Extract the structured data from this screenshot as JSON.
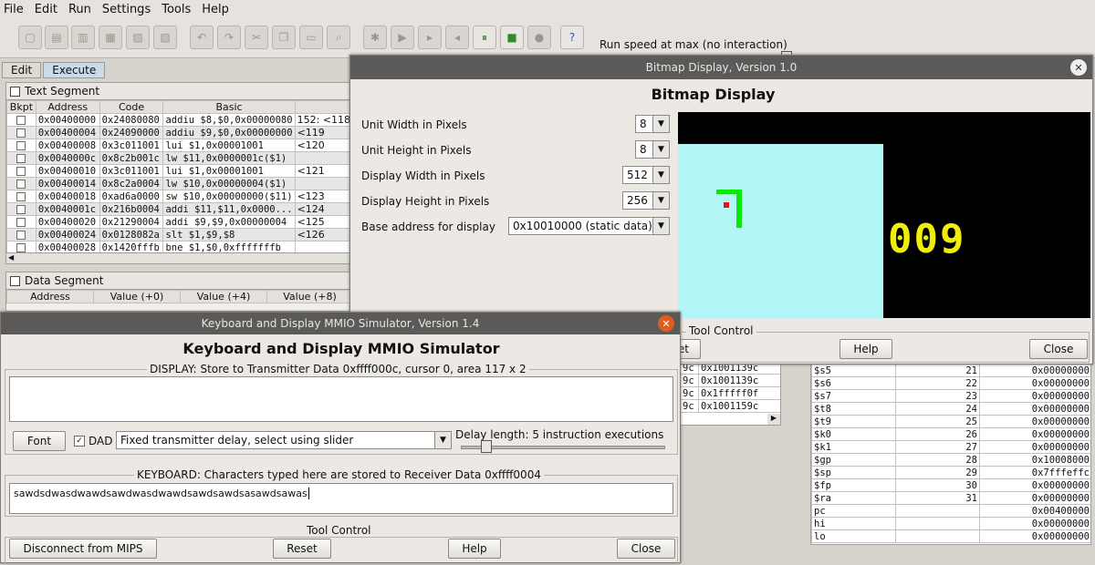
{
  "menu": [
    "File",
    "Edit",
    "Run",
    "Settings",
    "Tools",
    "Help"
  ],
  "toolbar": {
    "icons": [
      "new-icon",
      "open-icon",
      "close-file-icon",
      "save-icon",
      "dump-icon",
      "print-icon",
      "undo-icon",
      "redo-icon",
      "cut-icon",
      "copy-icon",
      "paste-icon",
      "find-icon",
      "assemble-icon",
      "run-icon",
      "step-icon",
      "backstep-icon",
      "pause-icon",
      "stop-icon",
      "reset-icon",
      "help-icon"
    ],
    "run_speed_label": "Run speed at max (no interaction)",
    "run_speed_fraction": 1.0
  },
  "tabs": {
    "edit": "Edit",
    "execute": "Execute"
  },
  "text_segment": {
    "title": "Text Segment",
    "headers": [
      "Bkpt",
      "Address",
      "Code",
      "Basic",
      ""
    ],
    "rows": [
      [
        "0x00400000",
        "0x24080080",
        "addiu $8,$0,0x00000080",
        "152:  <118"
      ],
      [
        "0x00400004",
        "0x24090000",
        "addiu $9,$0,0x00000000",
        "<119"
      ],
      [
        "0x00400008",
        "0x3c011001",
        "lui $1,0x00001001",
        "<120"
      ],
      [
        "0x0040000c",
        "0x8c2b001c",
        "lw $11,0x0000001c($1)",
        ""
      ],
      [
        "0x00400010",
        "0x3c011001",
        "lui $1,0x00001001",
        "<121"
      ],
      [
        "0x00400014",
        "0x8c2a0004",
        "lw $10,0x00000004($1)",
        ""
      ],
      [
        "0x00400018",
        "0xad6a0000",
        "sw $10,0x00000000($11)",
        "<123"
      ],
      [
        "0x0040001c",
        "0x216b0004",
        "addi $11,$11,0x0000...",
        "<124"
      ],
      [
        "0x00400020",
        "0x21290004",
        "addi $9,$9,0x00000004",
        "<125"
      ],
      [
        "0x00400024",
        "0x0128082a",
        "slt $1,$9,$8",
        "<126"
      ],
      [
        "0x00400028",
        "0x1420fffb",
        "bne $1,$0,0xfffffffb",
        ""
      ]
    ]
  },
  "data_segment": {
    "title": "Data Segment",
    "headers": [
      "Address",
      "Value (+0)",
      "Value (+4)",
      "Value (+8)"
    ],
    "partial_rows": [
      [
        "9c",
        "0x1001139c"
      ],
      [
        "9c",
        "0x1001139c"
      ],
      [
        "9c",
        "0x1fffff0f"
      ],
      [
        "9c",
        "0x1001159c"
      ]
    ],
    "partial_top": "0x100113..."
  },
  "bitmap": {
    "window_title": "Bitmap Display, Version 1.0",
    "heading": "Bitmap Display",
    "unit_width_label": "Unit Width in Pixels",
    "unit_width_value": "8",
    "unit_height_label": "Unit Height in Pixels",
    "unit_height_value": "8",
    "display_width_label": "Display Width in Pixels",
    "display_width_value": "512",
    "display_height_label": "Display Height in Pixels",
    "display_height_value": "256",
    "base_address_label": "Base address for display",
    "base_address_value": "0x10010000 (static data)",
    "score": "009",
    "tool_control": "Tool Control",
    "reset_partial": "et",
    "help": "Help",
    "close": "Close",
    "colors": {
      "playfield": "#b3f6f7",
      "snake": "#08e808",
      "food": "#e81010",
      "score": "#f0ee08",
      "background": "#000000"
    }
  },
  "registers": [
    [
      "$s5",
      "21",
      "0x00000000"
    ],
    [
      "$s6",
      "22",
      "0x00000000"
    ],
    [
      "$s7",
      "23",
      "0x00000000"
    ],
    [
      "$t8",
      "24",
      "0x00000000"
    ],
    [
      "$t9",
      "25",
      "0x00000000"
    ],
    [
      "$k0",
      "26",
      "0x00000000"
    ],
    [
      "$k1",
      "27",
      "0x00000000"
    ],
    [
      "$gp",
      "28",
      "0x10008000"
    ],
    [
      "$sp",
      "29",
      "0x7fffeffc"
    ],
    [
      "$fp",
      "30",
      "0x00000000"
    ],
    [
      "$ra",
      "31",
      "0x00000000"
    ],
    [
      "pc",
      "",
      "0x00400000"
    ],
    [
      "hi",
      "",
      "0x00000000"
    ],
    [
      "lo",
      "",
      "0x00000000"
    ]
  ],
  "mmio": {
    "window_title": "Keyboard and Display MMIO Simulator, Version 1.4",
    "heading": "Keyboard and Display MMIO Simulator",
    "display_label": "DISPLAY: Store to Transmitter Data 0xffff000c, cursor 0, area 117 x 2",
    "font_button": "Font",
    "dad_label": "DAD",
    "dad_checked": true,
    "delay_mode": "Fixed transmitter delay, select using slider",
    "delay_length": "Delay length: 5 instruction executions",
    "delay_fraction": 0.1,
    "keyboard_label": "KEYBOARD: Characters typed here are stored to Receiver Data 0xffff0004",
    "keyboard_text": "sawdsdwasdwawdsawdwasdwawdsawdsawdsasawdsawas",
    "tool_control": "Tool Control",
    "disconnect": "Disconnect from MIPS",
    "reset": "Reset",
    "help": "Help",
    "close": "Close"
  }
}
